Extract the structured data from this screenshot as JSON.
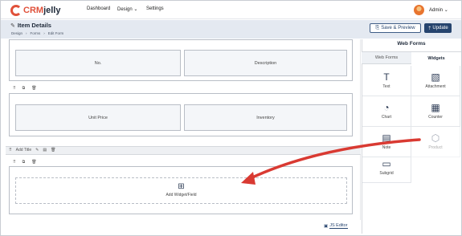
{
  "brand": {
    "crm": "CRM",
    "jelly": "jelly"
  },
  "nav": {
    "dashboard": "Dashboard",
    "design": "Design",
    "settings": "Settings"
  },
  "user": {
    "name": "Admin"
  },
  "header": {
    "title": "Item Details",
    "breadcrumbs": [
      "Design",
      "Forms",
      "Edit Form"
    ],
    "save_preview": "Save & Preview",
    "update": "Update"
  },
  "form": {
    "section1": {
      "field_left": "No.",
      "field_right": "Description"
    },
    "section2": {
      "field_left": "Unit Price",
      "field_right": "Inventory"
    },
    "add_title": "Add Title",
    "add_widget_field": "Add Widget/Field"
  },
  "footer": {
    "js_editor": "JS Editor"
  },
  "panel": {
    "title": "Web Forms",
    "tabs": {
      "web_forms": "Web Forms",
      "widgets": "Widgets"
    },
    "widgets": [
      {
        "label": "Text",
        "icon": "text-icon"
      },
      {
        "label": "Attachment",
        "icon": "attachment-icon"
      },
      {
        "label": "Chart",
        "icon": "chart-icon"
      },
      {
        "label": "Counter",
        "icon": "counter-icon"
      },
      {
        "label": "Note",
        "icon": "note-icon"
      },
      {
        "label": "Product",
        "icon": "product-icon"
      },
      {
        "label": "Subgrid",
        "icon": "subgrid-icon"
      }
    ]
  },
  "colors": {
    "brand": "#e0513a",
    "primary": "#26446e",
    "annotation_arrow": "#d93a32"
  }
}
